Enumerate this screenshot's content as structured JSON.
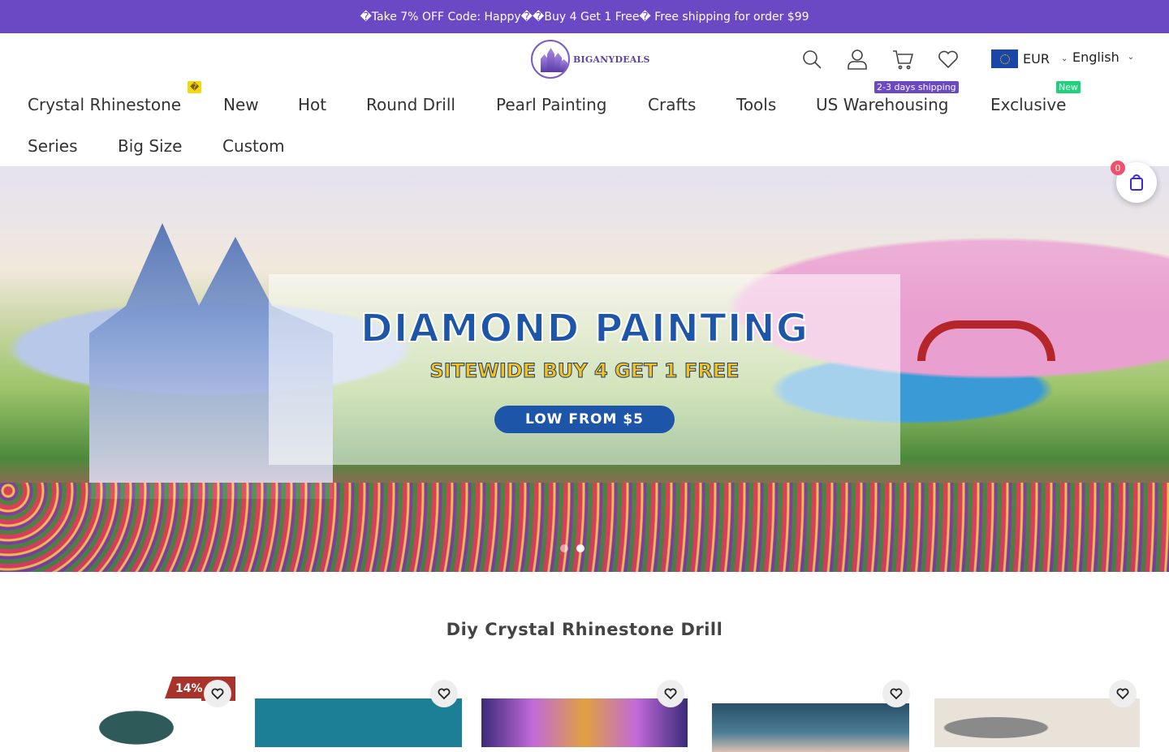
{
  "announcement": "�Take 7% OFF Code: Happy��Buy 4 Get 1 Free� Free shipping for order $99",
  "brand": {
    "name": "BIGANYDEALS",
    "accent": "#6b48c4"
  },
  "header_icons": [
    "search-icon",
    "account-icon",
    "cart-icon",
    "wishlist-icon"
  ],
  "currency": {
    "code": "EUR",
    "flag": "eu-flag"
  },
  "language": {
    "selected": "English"
  },
  "nav": {
    "items": [
      {
        "label": "Crystal Rhinestone",
        "badge": "�"
      },
      {
        "label": "New"
      },
      {
        "label": "Hot"
      },
      {
        "label": "Round Drill"
      },
      {
        "label": "Pearl Painting"
      },
      {
        "label": "Crafts"
      },
      {
        "label": "Tools"
      },
      {
        "label": "US Warehousing",
        "badge": "2-3 days shipping"
      },
      {
        "label": "Exclusive",
        "badge": "New"
      },
      {
        "label": "Series"
      },
      {
        "label": "Big Size"
      },
      {
        "label": "Custom"
      }
    ],
    "badge_colors": {
      "crystal": "#f5d90a",
      "us": "#6b48c4",
      "exclusive": "#1bd37a"
    }
  },
  "hero": {
    "title": "DIAMOND PAINTING",
    "subtitle": "SITEWIDE BUY 4 GET 1 FREE",
    "cta": "LOW FROM $5",
    "slides": 2,
    "active_slide": 1
  },
  "floating_cart": {
    "count": "0",
    "icon": "cart-icon"
  },
  "section": {
    "title": "Diy Crystal Rhinestone Drill"
  },
  "products": [
    {
      "discount": "14%",
      "icon": "heart-icon"
    },
    {
      "icon": "heart-icon"
    },
    {
      "icon": "heart-icon"
    },
    {
      "icon": "heart-icon"
    },
    {
      "icon": "heart-icon"
    }
  ]
}
